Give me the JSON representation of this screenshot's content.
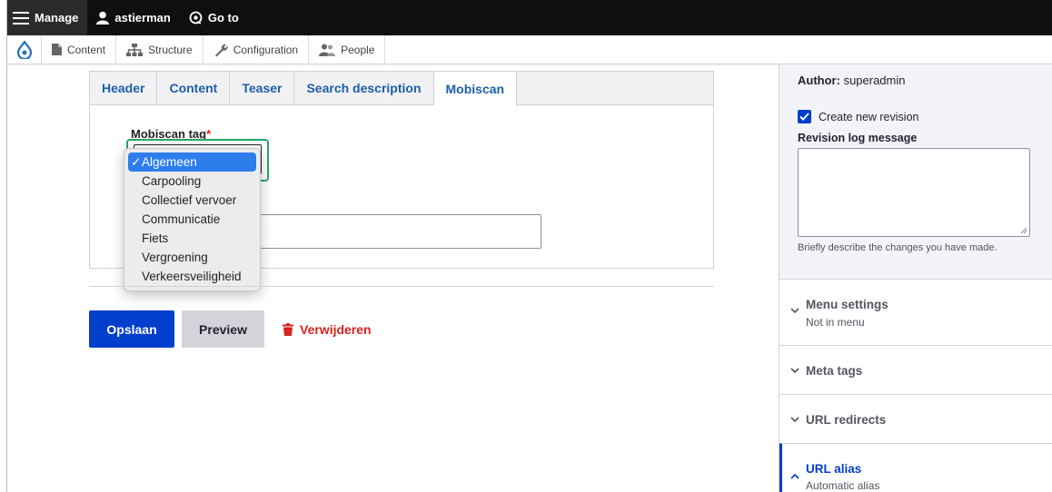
{
  "adminbar": {
    "manage_label": "Manage",
    "user_label": "astierman",
    "goto_label": "Go to"
  },
  "toolbar": {
    "items": [
      {
        "label": "Content",
        "icon": "page-icon"
      },
      {
        "label": "Structure",
        "icon": "structure-icon"
      },
      {
        "label": "Configuration",
        "icon": "wrench-icon"
      },
      {
        "label": "People",
        "icon": "people-icon"
      }
    ]
  },
  "tabs": [
    "Header",
    "Content",
    "Teaser",
    "Search description",
    "Mobiscan"
  ],
  "active_tab": "Mobiscan",
  "field": {
    "label": "Mobiscan tag",
    "required_mark": "*"
  },
  "dropdown": {
    "selected": "Algemeen",
    "check": "✓",
    "options": [
      "Algemeen",
      "Carpooling",
      "Collectief vervoer",
      "Communicatie",
      "Fiets",
      "Vergroening",
      "Verkeersveiligheid"
    ]
  },
  "buttons": {
    "save": "Opslaan",
    "preview": "Preview",
    "delete": "Verwijderen"
  },
  "sidebar": {
    "author_label": "Author:",
    "author_value": "superadmin",
    "create_revision": "Create new revision",
    "revision_log_label": "Revision log message",
    "revision_help": "Briefly describe the changes you have made.",
    "menu_settings_title": "Menu settings",
    "menu_settings_sub": "Not in menu",
    "meta_tags_title": "Meta tags",
    "url_redirects_title": "URL redirects",
    "url_alias_title": "URL alias",
    "url_alias_sub": "Automatic alias"
  },
  "colors": {
    "primary": "#003ecc",
    "danger": "#d72222",
    "focus": "#26a769",
    "select_highlight": "#2d7ded"
  }
}
